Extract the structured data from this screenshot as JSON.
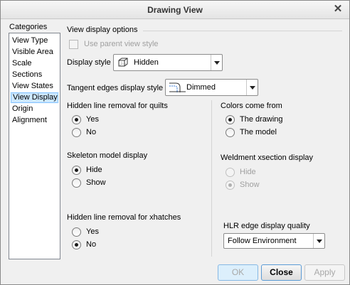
{
  "window": {
    "title": "Drawing View"
  },
  "categories": {
    "label": "Categories",
    "items": [
      {
        "label": "View Type"
      },
      {
        "label": "Visible Area"
      },
      {
        "label": "Scale"
      },
      {
        "label": "Sections"
      },
      {
        "label": "View States"
      },
      {
        "label": "View Display"
      },
      {
        "label": "Origin"
      },
      {
        "label": "Alignment"
      }
    ],
    "selected": "View Display"
  },
  "options": {
    "heading": "View display options",
    "use_parent_label": "Use parent view style",
    "display_style": {
      "label": "Display style",
      "value": "Hidden",
      "icon": "hidden-line-cube-icon"
    },
    "tangent_edges": {
      "label": "Tangent edges display style",
      "value": "Dimmed",
      "icon": "dimmed-tangent-edge-icon"
    }
  },
  "hidden_line_quilts": {
    "label": "Hidden line removal for quilts",
    "yes": "Yes",
    "no": "No",
    "selected": "Yes"
  },
  "skeleton_model": {
    "label": "Skeleton model display",
    "hide": "Hide",
    "show": "Show",
    "selected": "Hide"
  },
  "hidden_line_xhatches": {
    "label": "Hidden line removal for xhatches",
    "yes": "Yes",
    "no": "No",
    "selected": "No"
  },
  "colors_from": {
    "label": "Colors come from",
    "drawing": "The drawing",
    "model": "The model",
    "selected": "The drawing"
  },
  "weldment": {
    "label": "Weldment xsection display",
    "hide": "Hide",
    "show": "Show",
    "selected": "Show"
  },
  "hlr_quality": {
    "label": "HLR edge display quality",
    "value": "Follow Environment"
  },
  "buttons": {
    "ok": "OK",
    "close": "Close",
    "apply": "Apply"
  }
}
